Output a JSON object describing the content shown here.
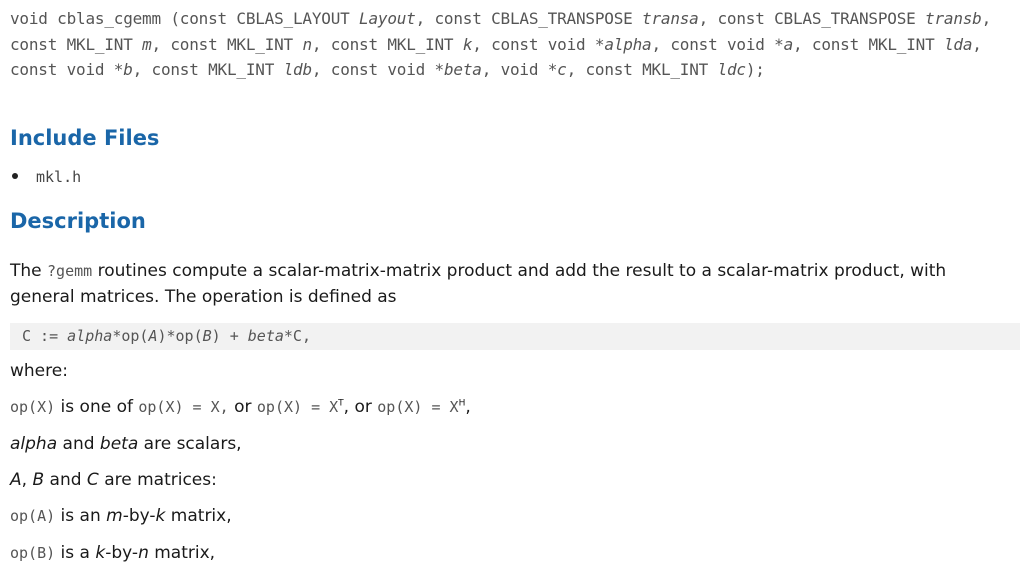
{
  "signature": {
    "p1": "void cblas_cgemm (const CBLAS_LAYOUT ",
    "layout": "Layout",
    "p2": ", const CBLAS_TRANSPOSE ",
    "transa": "transa",
    "p3": ", const CBLAS_TRANSPOSE ",
    "transb": "transb",
    "p4": ", const MKL_INT ",
    "m": "m",
    "p5": ", const MKL_INT ",
    "n": "n",
    "p6": ", const MKL_INT ",
    "k": "k",
    "p7": ", const void ",
    "alpha": "*alpha",
    "p8": ", const void ",
    "a": "*a",
    "p9": ", const MKL_INT ",
    "lda": "lda",
    "p10": ", const void ",
    "b": "*b",
    "p11": ", const MKL_INT ",
    "ldb": "ldb",
    "p12": ", const void ",
    "beta": "*beta",
    "p13": ", void ",
    "c": "*c",
    "p14": ", const MKL_INT ",
    "ldc": "ldc",
    "p15": ");"
  },
  "include": {
    "heading": "Include Files",
    "file": "mkl.h"
  },
  "description": {
    "heading": "Description",
    "intro_pre": "The ",
    "intro_code": "?gemm",
    "intro_post": " routines compute a scalar-matrix-matrix product and add the result to a scalar-matrix product, with general matrices. The operation is defined as",
    "formula_pre": "C := ",
    "formula_alpha": "alpha",
    "formula_mid1": "*op(",
    "formula_a": "A",
    "formula_mid2": ")*op(",
    "formula_b": "B",
    "formula_mid3": ") + ",
    "formula_beta": "beta",
    "formula_post": "*C,",
    "where": "where:",
    "op_code1": "op(X)",
    "op_t1": " is one of ",
    "op_code2": "op(X)",
    "op_eq1": " = X,",
    "op_t2": " or ",
    "op_code3": "op(X)",
    "op_eq2": " = X",
    "op_sup1": "T",
    "op_t3": ", or ",
    "op_code4": "op(X)",
    "op_eq3": " = X",
    "op_sup2": "H",
    "op_end": ",",
    "scalars_alpha": "alpha",
    "scalars_and": " and ",
    "scalars_beta": "beta",
    "scalars_post": " are scalars,",
    "mat_a": "A",
    "mat_comma": ", ",
    "mat_b": "B",
    "mat_and": " and ",
    "mat_c": "C",
    "mat_post": " are matrices:",
    "opa_code": "op(A)",
    "opa_pre": " is an ",
    "opa_m": "m",
    "opa_by1": "-by-",
    "opa_k": "k",
    "opa_post": " matrix,",
    "opb_code": "op(B)",
    "opb_pre": " is a ",
    "opb_k": "k",
    "opb_by1": "-by-",
    "opb_n": "n",
    "opb_post": " matrix,"
  }
}
